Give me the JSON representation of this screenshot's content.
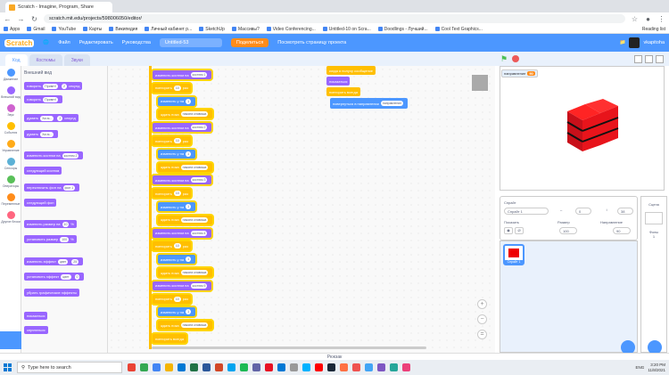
{
  "browser": {
    "tab_title": "Scratch - Imagine, Program, Share",
    "url": "scratch.mit.edu/projects/598006050/editor/",
    "reading_list": "Reading list",
    "bookmarks": [
      "Apps",
      "Gmail",
      "YouTube",
      "Карты",
      "Википедия",
      "Личный кабинет р...",
      "SketchUp",
      "Массивы?",
      "Video Conferencing...",
      "Untitled-10 on Scra...",
      "Doodlings - Лучший...",
      "Cool Text Graphics..."
    ]
  },
  "menubar": {
    "logo": "Scratch",
    "file": "Файл",
    "edit": "Редактировать",
    "tutorials": "Руководства",
    "project_title": "Untitled-53",
    "share": "Поделиться",
    "see_page": "Посмотреть страницу проекта",
    "username": "vkapitoha"
  },
  "tabs": {
    "code": "Код",
    "costumes": "Костюмы",
    "sounds": "Звуки"
  },
  "categories": [
    {
      "label": "Движение",
      "color": "#4c97ff"
    },
    {
      "label": "Внешний вид",
      "color": "#9966ff"
    },
    {
      "label": "Звук",
      "color": "#cf63cf"
    },
    {
      "label": "События",
      "color": "#ffbf00"
    },
    {
      "label": "Управление",
      "color": "#ffab19"
    },
    {
      "label": "Сенсоры",
      "color": "#5cb1d6"
    },
    {
      "label": "Операторы",
      "color": "#59c059"
    },
    {
      "label": "Переменные",
      "color": "#ff8c1a"
    },
    {
      "label": "Другие блоки",
      "color": "#ff6680"
    }
  ],
  "palette": {
    "section": "Внешний вид",
    "blocks": [
      {
        "text": "говорить",
        "slot": "Привет!",
        "extra": "2",
        "tail": "секунд",
        "color": "purple"
      },
      {
        "text": "говорить",
        "slot": "Привет!",
        "color": "purple"
      },
      {
        "text": "думать",
        "slot": "Хм-м...",
        "extra": "2",
        "tail": "секунд",
        "color": "purple"
      },
      {
        "text": "думать",
        "slot": "Хм-м...",
        "color": "purple"
      },
      {
        "text": "изменить костюм на",
        "slot": "костюм 2",
        "color": "purple"
      },
      {
        "text": "следующий костюм",
        "color": "purple"
      },
      {
        "text": "переключить фон на",
        "slot": "фон 1",
        "color": "purple"
      },
      {
        "text": "следующий фон",
        "color": "purple"
      },
      {
        "text": "изменить размер на",
        "slot": "10",
        "tail": "%",
        "color": "purple"
      },
      {
        "text": "установить размер",
        "slot": "100",
        "tail": "%",
        "color": "purple"
      },
      {
        "text": "изменить эффект",
        "slot": "цвет",
        "extra": "25",
        "color": "purple"
      },
      {
        "text": "установить эффект",
        "slot": "цвет",
        "extra": "0",
        "color": "purple"
      },
      {
        "text": "убрать графические эффекты",
        "color": "purple"
      },
      {
        "text": "показаться",
        "color": "purple"
      },
      {
        "text": "спрятаться",
        "color": "purple"
      }
    ]
  },
  "script": {
    "group": [
      {
        "text": "изменить костюм на",
        "slot": "костюм 1",
        "color": "purple"
      },
      {
        "text": "повторить",
        "slot": "10",
        "tail": "раз",
        "color": "yellow"
      },
      {
        "text": "изменить y на",
        "slot": "1",
        "color": "blue"
      },
      {
        "text": "ждать пока",
        "slot": "нажата клавиша",
        "color": "yellow"
      },
      {
        "text": "изменить костюм на",
        "slot": "костюм 2",
        "color": "purple"
      },
      {
        "text": "повторить",
        "slot": "10",
        "tail": "раз",
        "color": "yellow"
      },
      {
        "text": "изменить y на",
        "slot": "1",
        "color": "blue"
      },
      {
        "text": "ждать пока",
        "slot": "нажата клавиша",
        "color": "yellow"
      },
      {
        "text": "изменить костюм на",
        "slot": "костюм 3",
        "color": "purple"
      },
      {
        "text": "повторить",
        "slot": "10",
        "tail": "раз",
        "color": "yellow"
      },
      {
        "text": "изменить y на",
        "slot": "1",
        "color": "blue"
      },
      {
        "text": "ждать пока",
        "slot": "нажата клавиша",
        "color": "yellow"
      },
      {
        "text": "изменить костюм на",
        "slot": "костюм 4",
        "color": "purple"
      },
      {
        "text": "повторить",
        "slot": "10",
        "tail": "раз",
        "color": "yellow"
      },
      {
        "text": "изменить y на",
        "slot": "1",
        "color": "blue"
      },
      {
        "text": "ждать пока",
        "slot": "нажата клавиша",
        "color": "yellow"
      },
      {
        "text": "изменить костюм на",
        "slot": "костюм 5",
        "color": "purple"
      },
      {
        "text": "повторить",
        "slot": "10",
        "tail": "раз",
        "color": "yellow"
      },
      {
        "text": "изменить y на",
        "slot": "1",
        "color": "blue"
      },
      {
        "text": "ждать пока",
        "slot": "нажата клавиша",
        "color": "yellow"
      },
      {
        "text": "повторить всегда",
        "color": "yellow"
      }
    ],
    "side": [
      {
        "text": "когда я получу сообщение",
        "color": "yellow"
      },
      {
        "text": "показаться",
        "color": "purple"
      },
      {
        "text": "повторить всегда",
        "color": "yellow"
      },
      {
        "text": "повернуться в направлении",
        "slot": "направление",
        "color": "blue"
      }
    ]
  },
  "stage": {
    "monitor_label": "направление",
    "monitor_value": "90",
    "cube_color": "#e8141b"
  },
  "sprite_info": {
    "sprite_label": "Спрайт",
    "sprite_name": "Спрайт 1",
    "x_value": "0",
    "y_value": "38",
    "show_label": "Показать",
    "size_label": "Размер",
    "size_value": "100",
    "direction_label": "Направление",
    "direction_value": "90"
  },
  "sprites": [
    {
      "name": "Спрайт 1"
    }
  ],
  "stage_panel": {
    "label": "Сцена",
    "backdrops_label": "Фоны",
    "backdrops_count": "1"
  },
  "backpack": "Рюкзак",
  "taskbar": {
    "search_placeholder": "Type here to search",
    "time": "3:20 PM",
    "date": "11/8/2021",
    "lang": "ENG",
    "icons": [
      "#ea4335",
      "#34a853",
      "#4285f4",
      "#f4b400",
      "#0078d4",
      "#217346",
      "#2b579a",
      "#d24726",
      "#00a4ef",
      "#1db954",
      "#6264a7",
      "#e81123",
      "#0078d4",
      "#999999",
      "#00b2ff",
      "#ff0000",
      "#1b2838",
      "#ff7043",
      "#ef5350",
      "#42a5f5",
      "#7e57c2",
      "#26a69a",
      "#ec407a"
    ]
  }
}
